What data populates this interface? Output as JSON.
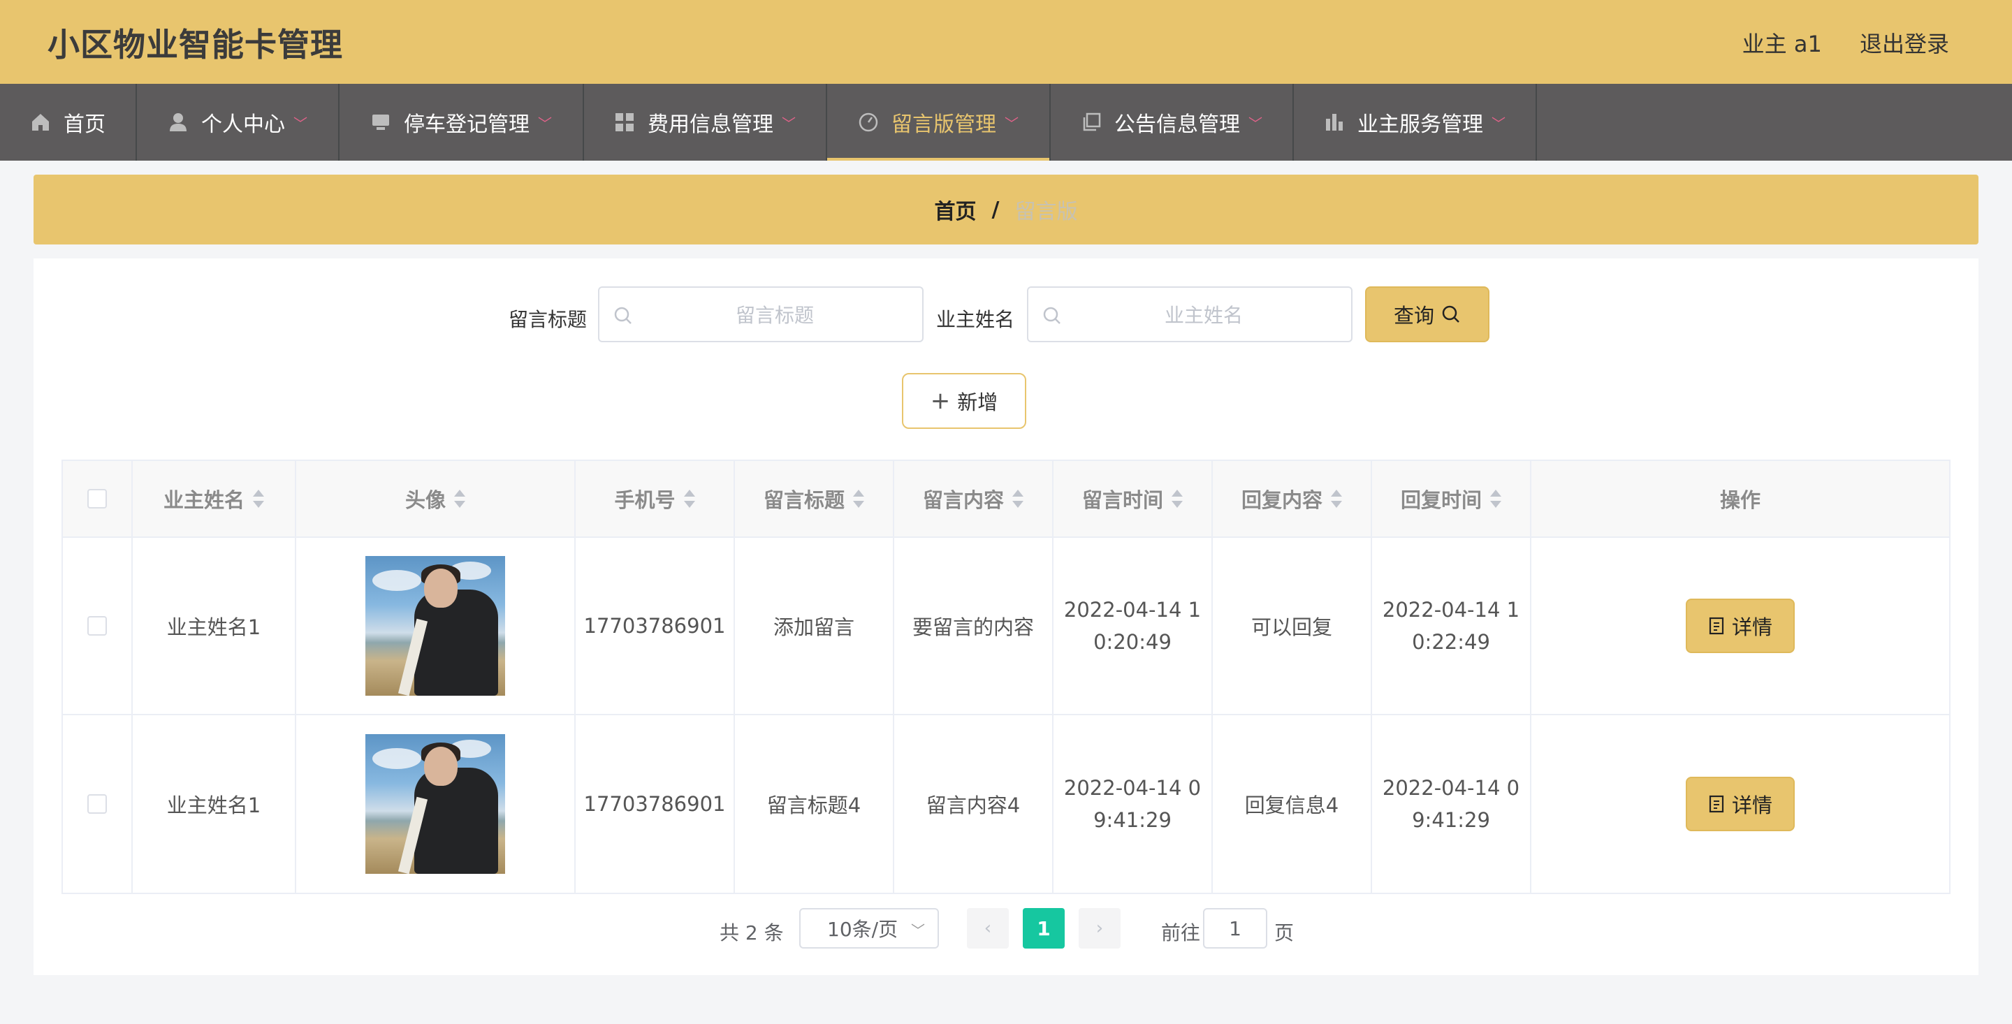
{
  "app": {
    "title": "小区物业智能卡管理"
  },
  "header": {
    "user_label": "业主 a1",
    "logout_label": "退出登录"
  },
  "nav": {
    "items": [
      {
        "label": "首页",
        "icon": "home-icon",
        "has_caret": false,
        "active": false
      },
      {
        "label": "个人中心",
        "icon": "user-icon",
        "has_caret": true,
        "active": false
      },
      {
        "label": "停车登记管理",
        "icon": "monitor-icon",
        "has_caret": true,
        "active": false
      },
      {
        "label": "费用信息管理",
        "icon": "grid-icon",
        "has_caret": true,
        "active": false
      },
      {
        "label": "留言版管理",
        "icon": "gauge-icon",
        "has_caret": true,
        "active": true
      },
      {
        "label": "公告信息管理",
        "icon": "copy-icon",
        "has_caret": true,
        "active": false
      },
      {
        "label": "业主服务管理",
        "icon": "bar-chart-icon",
        "has_caret": true,
        "active": false
      }
    ],
    "active_color": "#e8c56e",
    "caret_color": "#e2628a"
  },
  "breadcrumb": {
    "home": "首页",
    "separator": "/",
    "current": "留言版"
  },
  "search": {
    "title_label": "留言标题",
    "title_placeholder": "留言标题",
    "title_value": "",
    "name_label": "业主姓名",
    "name_placeholder": "业主姓名",
    "name_value": "",
    "query_label": "查询"
  },
  "add_label": "新增",
  "table": {
    "columns": [
      "业主姓名",
      "头像",
      "手机号",
      "留言标题",
      "留言内容",
      "留言时间",
      "回复内容",
      "回复时间",
      "操作"
    ],
    "rows": [
      {
        "owner_name": "业主姓名1",
        "phone": "17703786901",
        "title": "添加留言",
        "content": "要留言的内容",
        "message_time": "2022-04-14 10:20:49",
        "reply": "可以回复",
        "reply_time": "2022-04-14 10:22:49",
        "action": "详情"
      },
      {
        "owner_name": "业主姓名1",
        "phone": "17703786901",
        "title": "留言标题4",
        "content": "留言内容4",
        "message_time": "2022-04-14 09:41:29",
        "reply": "回复信息4",
        "reply_time": "2022-04-14 09:41:29",
        "action": "详情"
      }
    ]
  },
  "pagination": {
    "total_text": "共 2 条",
    "page_size": "10条/页",
    "current_page": "1",
    "goto_prefix": "前往",
    "goto_value": "1",
    "goto_suffix": "页"
  },
  "colors": {
    "brand": "#e8c56e",
    "nav_bg": "#5d5b5c",
    "page_active": "#16c7a0"
  }
}
